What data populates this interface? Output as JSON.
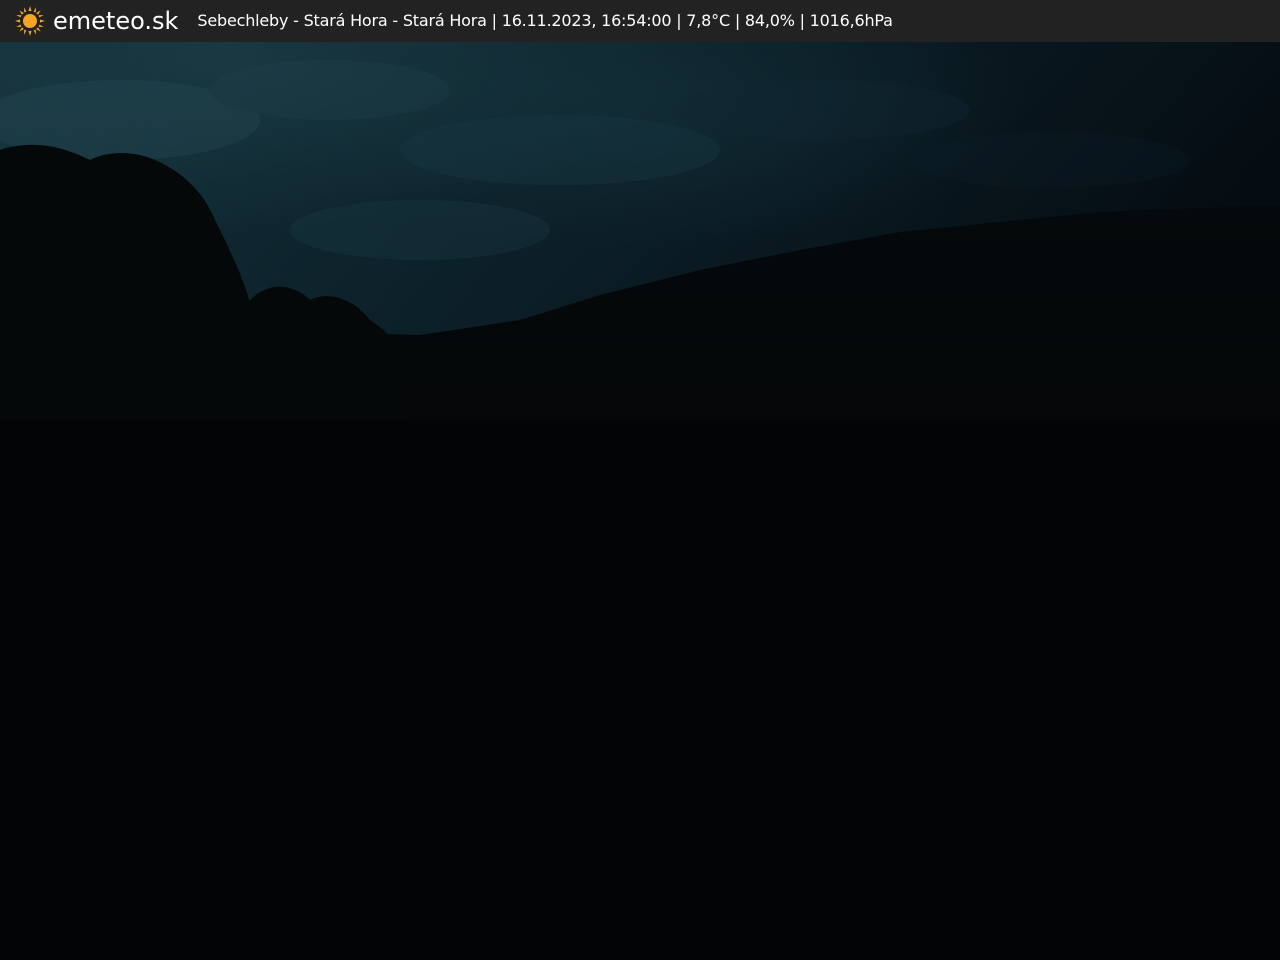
{
  "overlay": {
    "brand": "emeteo.sk",
    "caption": "Sebechleby - Stará Hora - Stará Hora | 16.11.2023, 16:54:00 | 7,8°C | 84,0% | 1016,6hPa",
    "logo_icon": "sun-icon"
  },
  "colors": {
    "bar_background": "#222222",
    "text": "#ffffff",
    "sun": "#f5a623",
    "sky": "#0e2a33",
    "ground": "#030405"
  }
}
